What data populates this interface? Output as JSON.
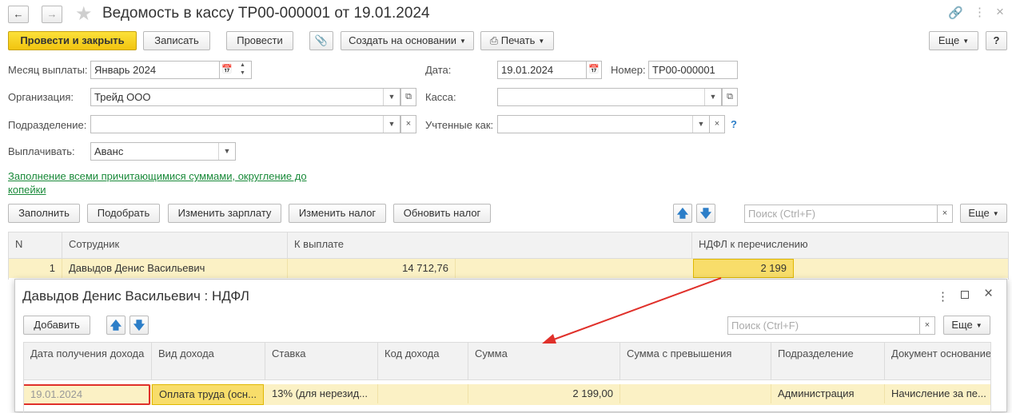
{
  "window": {
    "title": "Ведомость в кассу ТР00-000001 от 19.01.2024"
  },
  "toolbar": {
    "post_close": "Провести и закрыть",
    "save": "Записать",
    "post": "Провести",
    "create_based": "Создать на основании",
    "print": "Печать",
    "more": "Еще",
    "help": "?"
  },
  "form": {
    "month_label": "Месяц выплаты:",
    "month_value": "Январь 2024",
    "date_label": "Дата:",
    "date_value": "19.01.2024",
    "number_label": "Номер:",
    "number_value": "ТР00-000001",
    "org_label": "Организация:",
    "org_value": "Трейд ООО",
    "kassa_label": "Касса:",
    "kassa_value": "",
    "dept_label": "Подразделение:",
    "dept_value": "",
    "accounted_label": "Учтенные как:",
    "accounted_value": "",
    "pay_label": "Выплачивать:",
    "pay_value": "Аванс",
    "fill_link": "Заполнение всеми причитающимися суммами, округление до копейки"
  },
  "table_toolbar": {
    "fill": "Заполнить",
    "pick": "Подобрать",
    "change_salary": "Изменить зарплату",
    "change_tax": "Изменить налог",
    "update_tax": "Обновить налог",
    "search_placeholder": "Поиск (Ctrl+F)",
    "more": "Еще"
  },
  "main_table": {
    "columns": [
      "N",
      "Сотрудник",
      "К выплате",
      "НДФЛ к перечислению"
    ],
    "rows": [
      {
        "n": "1",
        "employee": "Давыдов Денис Васильевич",
        "pay": "14 712,76",
        "ndfl": "2 199"
      }
    ]
  },
  "popup": {
    "title": "Давыдов Денис Васильевич : НДФЛ",
    "add": "Добавить",
    "search_placeholder": "Поиск (Ctrl+F)",
    "more": "Еще",
    "columns": [
      "Дата получения дохода",
      "Вид дохода",
      "Ставка",
      "Код дохода",
      "Сумма",
      "Сумма с превышения",
      "Подразделение",
      "Документ основание"
    ],
    "rows": [
      {
        "date": "19.01.2024",
        "income_type": "Оплата труда (осн...",
        "rate": "13% (для нерезид...",
        "code": "",
        "sum": "2 199,00",
        "sum_excess": "",
        "dept": "Администрация",
        "doc": "Начисление за пе..."
      }
    ]
  },
  "colors": {
    "accent_yellow": "#f5d22b",
    "row_highlight": "#fbf1c5",
    "link_green": "#1a8a3a",
    "annotation_red": "#e0302a"
  }
}
